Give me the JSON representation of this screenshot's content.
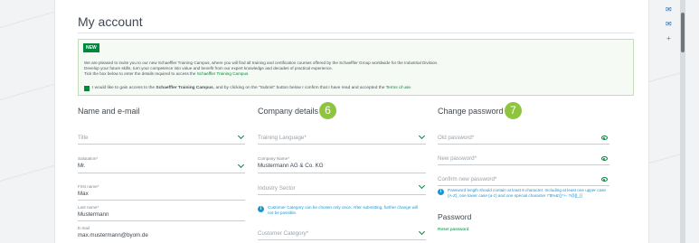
{
  "account": {
    "title": "My account"
  },
  "notice": {
    "badge": "NEW",
    "line1": "We are pleased to invite you to our new Schaeffler Training Campus, where you will find all training and certification courses offered by the Schaeffler Group worldwide for the Industrial Division.",
    "line2": "Develop your future skills, turn your competence into value and benefit from our expert knowledge and decades of practical experience.",
    "line3_prefix": "Tick the box below to enter the details required to access the ",
    "line3_link": "Schaeffler Training Campus.",
    "consent_prefix": "I would like to gain access to the ",
    "consent_campus": "Schaeffler Training Campus",
    "consent_middle": ", and by clicking on the \"Submit\" button below I confirm that I have read and accepted the ",
    "consent_terms": "Terms of use."
  },
  "name_section": {
    "heading": "Name and e-mail",
    "title_placeholder": "Title",
    "salutation_label": "Salutation*",
    "salutation_value": "Mr.",
    "first_name_label": "First name*",
    "first_name_value": "Max",
    "last_name_label": "Last name*",
    "last_name_value": "Mustermann",
    "email_label": "E-mail",
    "email_value": "max.mustermann@byom.de"
  },
  "company_section": {
    "heading": "Company details",
    "step": "6",
    "training_language_placeholder": "Training Language*",
    "company_name_label": "Company Name*",
    "company_name_value": "Mustermann AG & Co. KG",
    "industry_sector_placeholder": "Industry Sector",
    "info": "Customer Category can be chosen only once. After submitting, further change will not be possible.",
    "customer_category_placeholder": "Customer Category*"
  },
  "password_section": {
    "heading": "Change password",
    "step": "7",
    "old_password_placeholder": "Old password*",
    "new_password_placeholder": "New password*",
    "confirm_password_placeholder": "Confirm new password*",
    "rules": "Password length should contain at least 8 character. Including at least one upper case (A-Z), one lower case (a-z) and one special character !\"$%&'()*+-:?@[]_{}",
    "password_heading": "Password",
    "reset_link": "Reset password"
  },
  "colors": {
    "accent_green": "#00893d",
    "step_badge": "#8fc43e",
    "info_blue": "#1c95d2"
  },
  "icons": [
    "chevron-down-icon",
    "eye-icon",
    "info-icon",
    "mail-icon",
    "plus-icon"
  ]
}
